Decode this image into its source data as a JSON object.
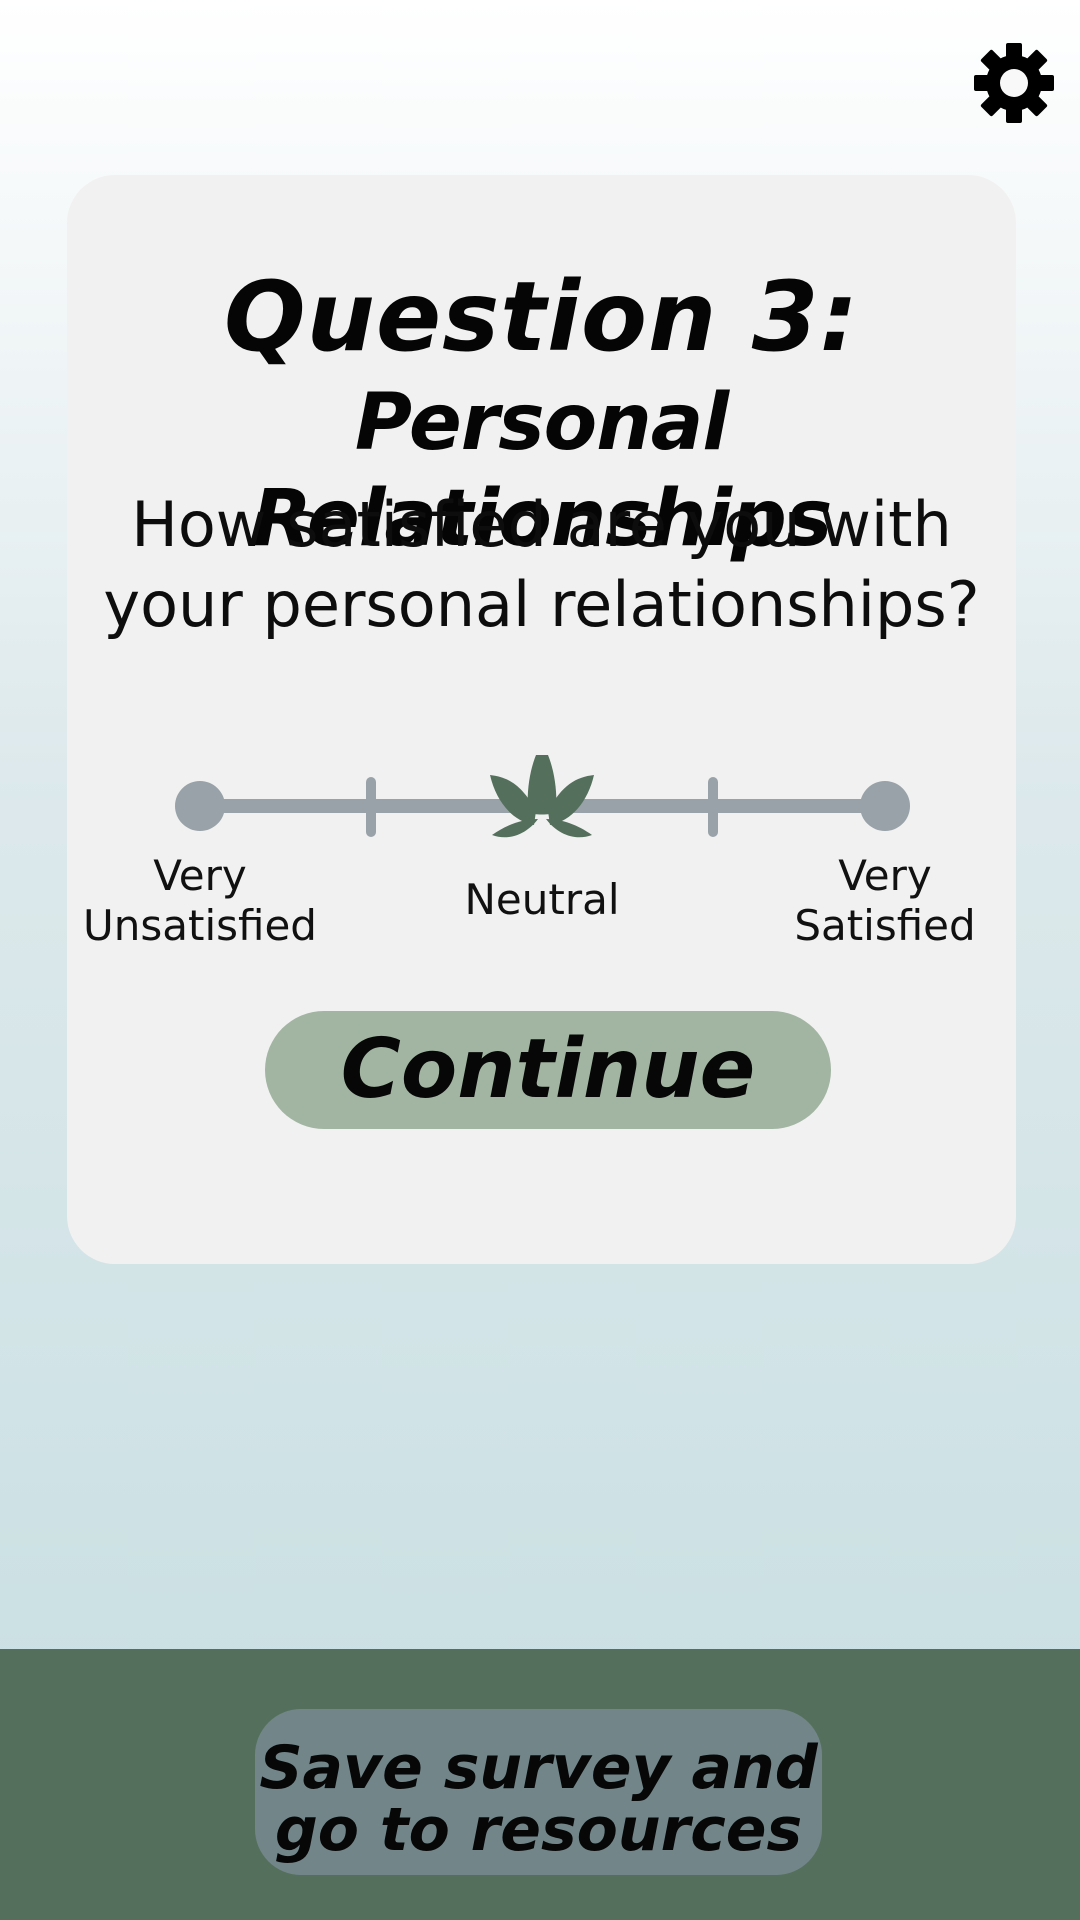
{
  "header": {
    "settings_icon": "gear-icon"
  },
  "survey": {
    "title_line1": "Question 3:",
    "title_line2": "Personal Relationships",
    "question_line1": "How satisfied are you with",
    "question_line2": "your personal relationships?",
    "scale": {
      "left_label_line1": "Very",
      "left_label_line2": "Unsatisfied",
      "center_label": "Neutral",
      "right_label_line1": "Very",
      "right_label_line2": "Satisfied",
      "steps": 5,
      "selected_step": 3,
      "thumb_icon": "leaf-icon"
    },
    "continue_label": "Continue"
  },
  "footer": {
    "save_label_line1": "Save survey and",
    "save_label_line2": "go to resources"
  },
  "colors": {
    "card_bg": "#f1f1f1",
    "track": "#98a2a8",
    "thumb": "#54705c",
    "continue_bg": "#a2b5a2",
    "footer_bg": "#54705c",
    "save_bg": "#72868a"
  }
}
